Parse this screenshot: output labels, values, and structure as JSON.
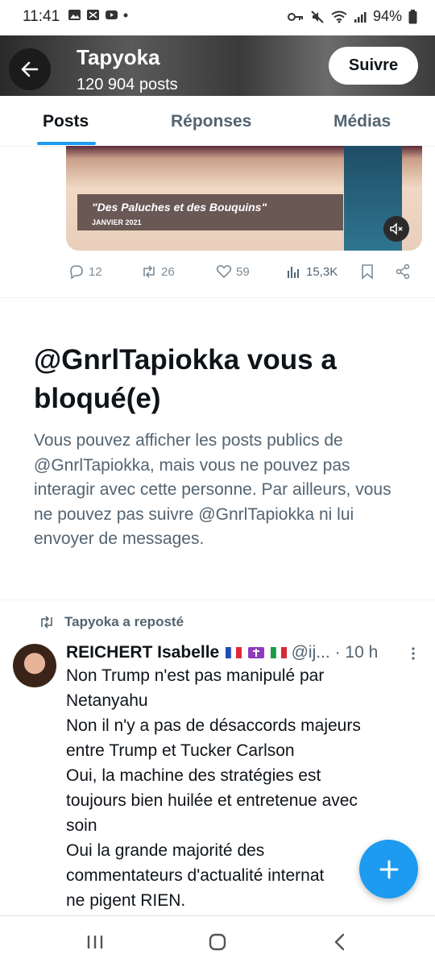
{
  "status_bar": {
    "time": "11:41",
    "battery": "94%",
    "left_icons": [
      "image-icon",
      "scissors-icon",
      "youtube-icon",
      "dot-icon"
    ],
    "right_icons": [
      "key-icon",
      "mute-icon",
      "wifi-icon",
      "signal-icon",
      "battery-icon"
    ]
  },
  "header": {
    "name": "Tapyoka",
    "post_count": "120 904 posts",
    "follow_label": "Suivre"
  },
  "tabs": [
    {
      "label": "Posts",
      "active": true
    },
    {
      "label": "Réponses",
      "active": false
    },
    {
      "label": "Médias",
      "active": false
    }
  ],
  "media": {
    "caption_title": "\"Des Paluches et des Bouquins\"",
    "caption_date": "JANVIER 2021",
    "mute_icon": "volume-mute-icon"
  },
  "actions": {
    "replies": "12",
    "reposts": "26",
    "likes": "59",
    "views": "15,3K"
  },
  "blocked": {
    "title": "@GnrlTapiokka vous a bloqué(e)",
    "text": "Vous pouvez afficher les posts publics de @GnrlTapiokka, mais vous ne pouvez pas interagir avec cette personne. Par ailleurs, vous ne pouvez pas suivre @GnrlTapiokka ni lui envoyer de messages."
  },
  "tweet": {
    "repost_label": "Tapyoka a reposté",
    "author": "REICHERT Isabelle",
    "handle": "@ij...",
    "time": "· 10 h",
    "body": "Non Trump n'est pas manipulé par\nNetanyahu\nNon il n'y a pas de désaccords majeurs\nentre Trump et Tucker Carlson\nOui, la machine des stratégies est\ntoujours bien huilée et entretenue avec\nsoin\nOui  la grande majorité des\ncommentateurs d'actualité internat\nne pigent RIEN."
  },
  "colors": {
    "accent": "#1d9bf0",
    "text_primary": "#0f1419",
    "text_secondary": "#536471"
  }
}
